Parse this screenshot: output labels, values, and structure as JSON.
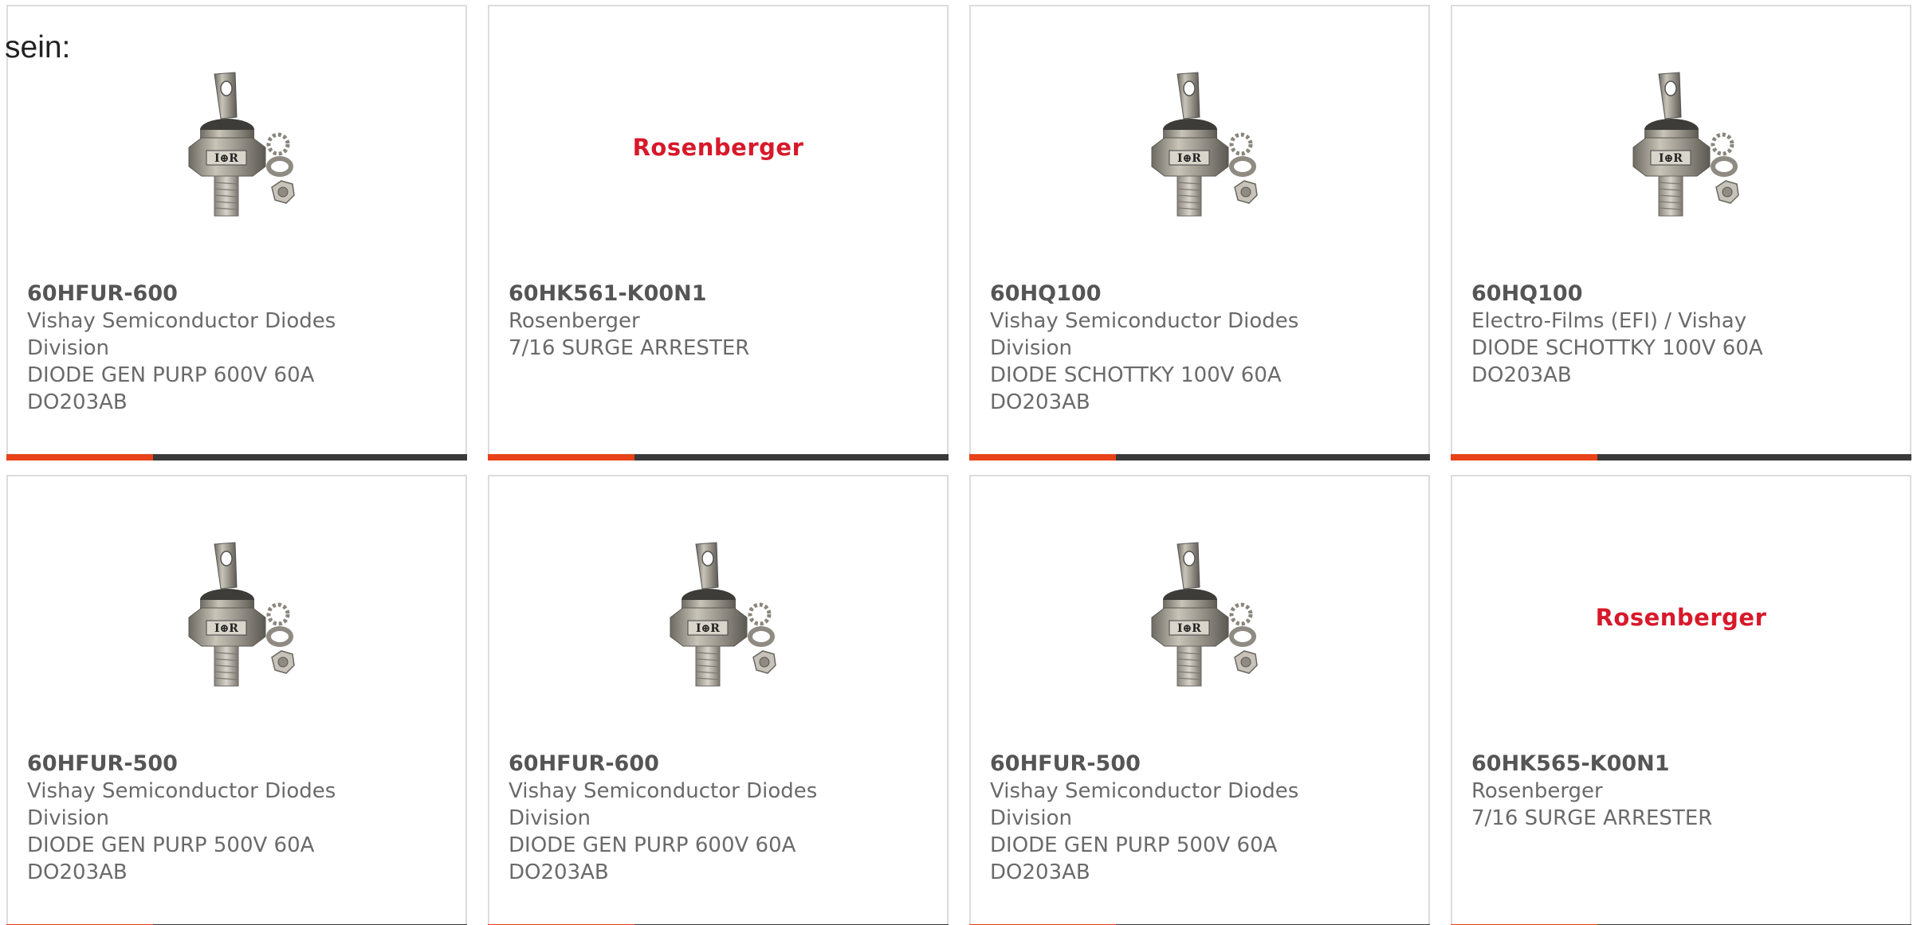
{
  "intro": {
    "text": "sein:"
  },
  "colors": {
    "accent": "#e8421a",
    "bar": "#3a3a3a",
    "logo_red": "#d7192a",
    "border": "#dcdcdc"
  },
  "cards": [
    {
      "part": "60HFUR-600",
      "manufacturer": "Vishay Semiconductor Diodes",
      "manufacturer2": "Division",
      "desc": "DIODE GEN PURP 600V 60A",
      "desc2": "DO203AB",
      "image": "stud-diode-image"
    },
    {
      "part": "60HK561-K00N1",
      "manufacturer": "Rosenberger",
      "manufacturer2": "",
      "desc": "7/16 SURGE ARRESTER",
      "desc2": "",
      "image": "rosenberger-logo",
      "logo_text": "Rosenberger"
    },
    {
      "part": "60HQ100",
      "manufacturer": "Vishay Semiconductor Diodes",
      "manufacturer2": "Division",
      "desc": "DIODE SCHOTTKY 100V 60A",
      "desc2": "DO203AB",
      "image": "stud-diode-image"
    },
    {
      "part": "60HQ100",
      "manufacturer": "Electro-Films (EFI) / Vishay",
      "manufacturer2": "",
      "desc": "DIODE SCHOTTKY 100V 60A",
      "desc2": "DO203AB",
      "image": "stud-diode-image"
    },
    {
      "part": "60HFUR-500",
      "manufacturer": "Vishay Semiconductor Diodes",
      "manufacturer2": "Division",
      "desc": "DIODE GEN PURP 500V 60A",
      "desc2": "DO203AB",
      "image": "stud-diode-image"
    },
    {
      "part": "60HFUR-600",
      "manufacturer": "Vishay Semiconductor Diodes",
      "manufacturer2": "Division",
      "desc": "DIODE GEN PURP 600V 60A",
      "desc2": "DO203AB",
      "image": "stud-diode-image"
    },
    {
      "part": "60HFUR-500",
      "manufacturer": "Vishay Semiconductor Diodes",
      "manufacturer2": "Division",
      "desc": "DIODE GEN PURP 500V 60A",
      "desc2": "DO203AB",
      "image": "stud-diode-image"
    },
    {
      "part": "60HK565-K00N1",
      "manufacturer": "Rosenberger",
      "manufacturer2": "",
      "desc": "7/16 SURGE ARRESTER",
      "desc2": "",
      "image": "rosenberger-logo",
      "logo_text": "Rosenberger"
    }
  ]
}
